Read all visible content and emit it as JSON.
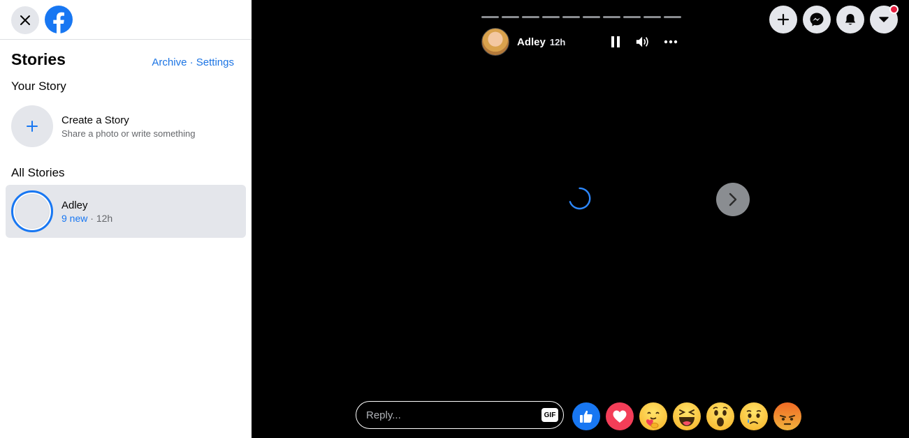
{
  "sidebar": {
    "title": "Stories",
    "archive_label": "Archive",
    "links_separator": "·",
    "settings_label": "Settings",
    "your_story_title": "Your Story",
    "create_title": "Create a Story",
    "create_subtitle": "Share a photo or write something",
    "all_stories_title": "All Stories",
    "stories": [
      {
        "name": "Adley",
        "new_count": "9 new",
        "age": "12h"
      }
    ]
  },
  "viewer": {
    "author_name": "Adley",
    "author_time": "12h",
    "progress_segments": 10,
    "reply_placeholder": "Reply...",
    "gif_label": "GIF",
    "reactions": [
      "like",
      "love",
      "care",
      "haha",
      "wow",
      "sad",
      "angry"
    ]
  },
  "header_actions": [
    "create-icon",
    "messenger-icon",
    "notifications-icon",
    "account-menu-icon"
  ],
  "colors": {
    "accent": "#1877f2",
    "link": "#1b74e4",
    "viewer_bg": "#000000",
    "notification": "#e41e3f"
  }
}
